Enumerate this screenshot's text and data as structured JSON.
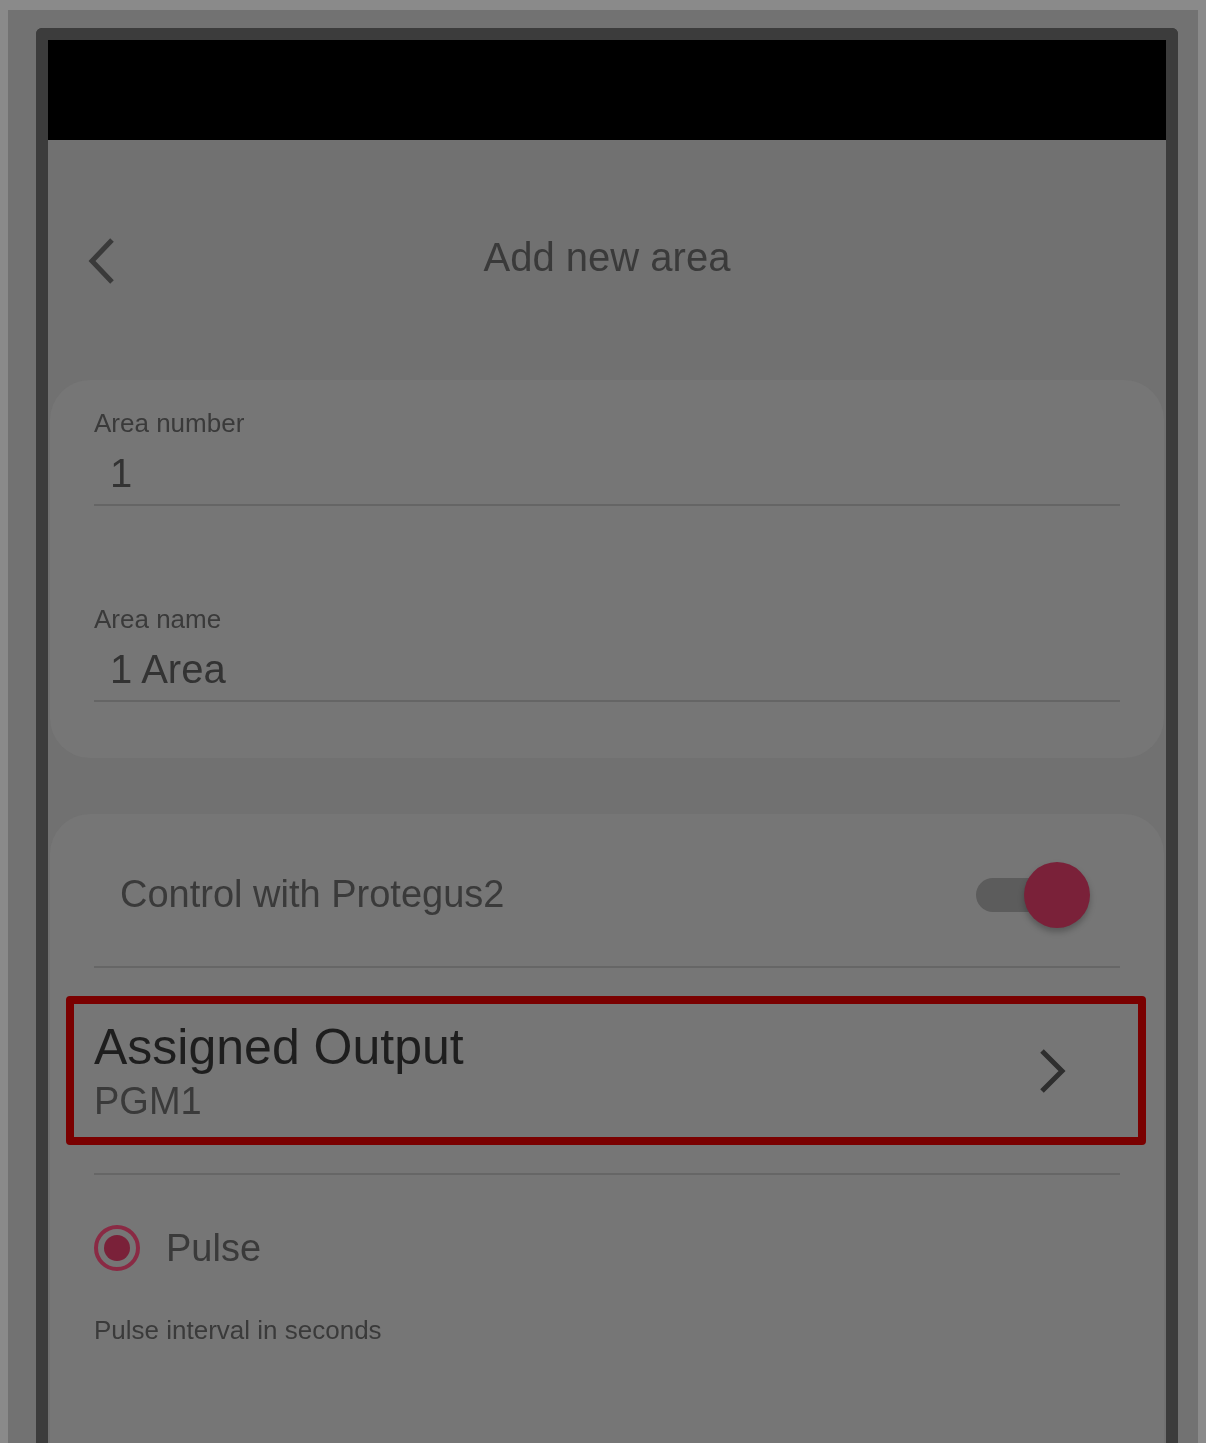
{
  "header": {
    "title": "Add new area"
  },
  "fields": [
    {
      "label": "Area number",
      "value": "1"
    },
    {
      "label": "Area name",
      "value": "1 Area"
    }
  ],
  "control": {
    "label": "Control with Protegus2",
    "on": true
  },
  "assigned_output": {
    "title": "Assigned Output",
    "value": "PGM1",
    "highlighted": true
  },
  "mode": {
    "label": "Pulse",
    "selected": true
  },
  "pulse_interval": {
    "label": "Pulse interval in seconds"
  }
}
